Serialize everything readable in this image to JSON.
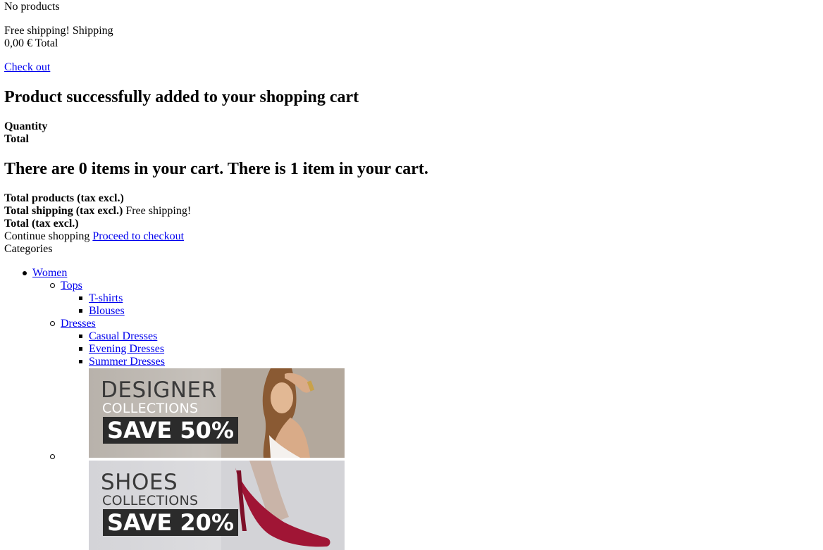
{
  "cart_summary": {
    "no_products": "No products",
    "shipping_value": "Free shipping!",
    "shipping_label": "Shipping",
    "total_value": "0,00 €",
    "total_label": "Total",
    "checkout_link": "Check out"
  },
  "layer_cart": {
    "success_title": "Product successfully added to your shopping cart",
    "quantity_label": "Quantity",
    "total_label": "Total",
    "cart_count_title": "There are 0 items in your cart. There is 1 item in your cart.",
    "total_products_label": "Total products (tax excl.)",
    "total_shipping_label": "Total shipping",
    "total_shipping_suffix": "(tax excl.)",
    "total_shipping_value": "Free shipping!",
    "total_label_full": "Total (tax excl.)",
    "continue_shopping": "Continue shopping",
    "proceed_to_checkout": "Proceed to checkout"
  },
  "categories": {
    "heading": "Categories",
    "women": "Women",
    "tops": "Tops",
    "tshirts": "T-shirts",
    "blouses": "Blouses",
    "dresses": "Dresses",
    "casual_dresses": "Casual Dresses",
    "evening_dresses": "Evening Dresses",
    "summer_dresses": "Summer Dresses"
  },
  "banners": [
    {
      "title": "DESIGNER",
      "subtitle": "COLLECTIONS",
      "offer": "SAVE 50%",
      "image_icon": "woman-model-image"
    },
    {
      "title": "SHOES",
      "subtitle": "COLLECTIONS",
      "offer": "SAVE 20%",
      "image_icon": "red-high-heel-image"
    }
  ],
  "colors": {
    "link": "#0000ee",
    "offer_bg": "#2b2b2b",
    "heel_red": "#a01535"
  }
}
